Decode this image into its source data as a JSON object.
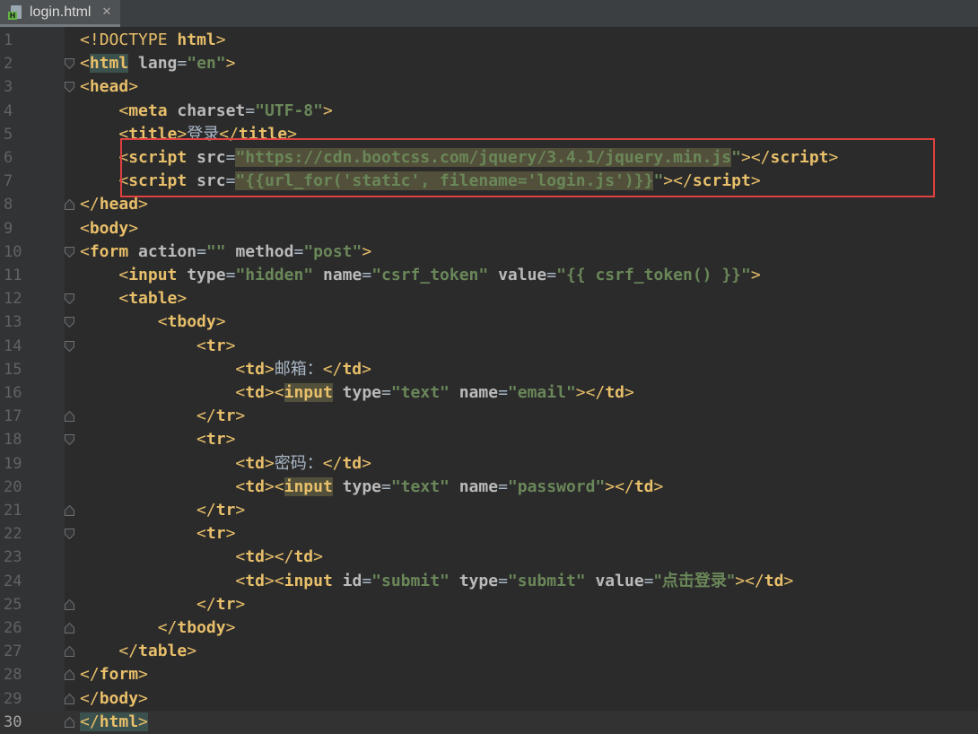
{
  "tab": {
    "filename": "login.html",
    "close_glyph": "✕",
    "icon": "html-file-icon"
  },
  "active_line": 30,
  "lines": [
    {
      "n": "1",
      "tokens": [
        [
          "tb",
          "<!"
        ],
        [
          "tb",
          "DOCTYPE "
        ],
        [
          "tn",
          "html"
        ],
        [
          "tb",
          ">"
        ]
      ]
    },
    {
      "n": "2",
      "tokens": [
        [
          "tb",
          "<"
        ],
        [
          "tn",
          "html",
          "hl"
        ],
        [
          "tx",
          " "
        ],
        [
          "an",
          "lang"
        ],
        [
          "tx",
          "="
        ],
        [
          "av",
          "\"en\""
        ],
        [
          "tb",
          ">"
        ]
      ]
    },
    {
      "n": "3",
      "tokens": [
        [
          "tb",
          "<"
        ],
        [
          "tn",
          "head"
        ],
        [
          "tb",
          ">"
        ]
      ]
    },
    {
      "n": "4",
      "tokens": [
        [
          "tx",
          "    "
        ],
        [
          "tb",
          "<"
        ],
        [
          "tn",
          "meta"
        ],
        [
          "tx",
          " "
        ],
        [
          "an",
          "charset"
        ],
        [
          "tx",
          "="
        ],
        [
          "av",
          "\"UTF-8\""
        ],
        [
          "tb",
          ">"
        ]
      ]
    },
    {
      "n": "5",
      "tokens": [
        [
          "tx",
          "    "
        ],
        [
          "tb",
          "<"
        ],
        [
          "tn",
          "title"
        ],
        [
          "tb",
          ">"
        ],
        [
          "tx",
          "登录",
          "cjk"
        ],
        [
          "tb",
          "</"
        ],
        [
          "tn",
          "title"
        ],
        [
          "tb",
          ">"
        ]
      ]
    },
    {
      "n": "6",
      "tokens": [
        [
          "tx",
          "    "
        ],
        [
          "tb",
          "<"
        ],
        [
          "tn",
          "script"
        ],
        [
          "tx",
          " "
        ],
        [
          "an",
          "src"
        ],
        [
          "tx",
          "="
        ],
        [
          "av",
          "\"https://cdn.bootcss.com/jquery/3.4.1/jquery.min.js",
          "hlm"
        ],
        [
          "av",
          "\""
        ],
        [
          "tb",
          ">"
        ],
        [
          "tb",
          "</"
        ],
        [
          "tn",
          "script"
        ],
        [
          "tb",
          ">"
        ]
      ]
    },
    {
      "n": "7",
      "tokens": [
        [
          "tx",
          "    "
        ],
        [
          "tb",
          "<"
        ],
        [
          "tn",
          "script"
        ],
        [
          "tx",
          " "
        ],
        [
          "an",
          "src"
        ],
        [
          "tx",
          "="
        ],
        [
          "av",
          "\"{{url_for('static', filename='login.js')}}",
          "hlm"
        ],
        [
          "av",
          "\""
        ],
        [
          "tb",
          ">"
        ],
        [
          "tb",
          "</"
        ],
        [
          "tn",
          "script"
        ],
        [
          "tb",
          ">"
        ]
      ]
    },
    {
      "n": "8",
      "tokens": [
        [
          "tb",
          "</"
        ],
        [
          "tn",
          "head"
        ],
        [
          "tb",
          ">"
        ]
      ]
    },
    {
      "n": "9",
      "tokens": [
        [
          "tb",
          "<"
        ],
        [
          "tn",
          "body"
        ],
        [
          "tb",
          ">"
        ]
      ]
    },
    {
      "n": "10",
      "tokens": [
        [
          "tb",
          "<"
        ],
        [
          "tn",
          "form"
        ],
        [
          "tx",
          " "
        ],
        [
          "an",
          "action"
        ],
        [
          "tx",
          "="
        ],
        [
          "av",
          "\"\""
        ],
        [
          "tx",
          " "
        ],
        [
          "an",
          "method"
        ],
        [
          "tx",
          "="
        ],
        [
          "av",
          "\"post\""
        ],
        [
          "tb",
          ">"
        ]
      ]
    },
    {
      "n": "11",
      "tokens": [
        [
          "tx",
          "    "
        ],
        [
          "tb",
          "<"
        ],
        [
          "tn",
          "input"
        ],
        [
          "tx",
          " "
        ],
        [
          "an",
          "type"
        ],
        [
          "tx",
          "="
        ],
        [
          "av",
          "\"hidden\""
        ],
        [
          "tx",
          " "
        ],
        [
          "an",
          "name"
        ],
        [
          "tx",
          "="
        ],
        [
          "av",
          "\"csrf_token\""
        ],
        [
          "tx",
          " "
        ],
        [
          "an",
          "value"
        ],
        [
          "tx",
          "="
        ],
        [
          "av",
          "\"{{ csrf_token() }}\""
        ],
        [
          "tb",
          ">"
        ]
      ]
    },
    {
      "n": "12",
      "tokens": [
        [
          "tx",
          "    "
        ],
        [
          "tb",
          "<"
        ],
        [
          "tn",
          "table"
        ],
        [
          "tb",
          ">"
        ]
      ]
    },
    {
      "n": "13",
      "tokens": [
        [
          "tx",
          "        "
        ],
        [
          "tb",
          "<"
        ],
        [
          "tn",
          "tbody"
        ],
        [
          "tb",
          ">"
        ]
      ]
    },
    {
      "n": "14",
      "tokens": [
        [
          "tx",
          "            "
        ],
        [
          "tb",
          "<"
        ],
        [
          "tn",
          "tr"
        ],
        [
          "tb",
          ">"
        ]
      ]
    },
    {
      "n": "15",
      "tokens": [
        [
          "tx",
          "                "
        ],
        [
          "tb",
          "<"
        ],
        [
          "tn",
          "td"
        ],
        [
          "tb",
          ">"
        ],
        [
          "tx",
          "邮箱：",
          "cjk"
        ],
        [
          "tb",
          "</"
        ],
        [
          "tn",
          "td"
        ],
        [
          "tb",
          ">"
        ]
      ]
    },
    {
      "n": "16",
      "tokens": [
        [
          "tx",
          "                "
        ],
        [
          "tb",
          "<"
        ],
        [
          "tn",
          "td"
        ],
        [
          "tb",
          ">"
        ],
        [
          "tb",
          "<"
        ],
        [
          "tn",
          "input",
          "hlm"
        ],
        [
          "tx",
          " "
        ],
        [
          "an",
          "type"
        ],
        [
          "tx",
          "="
        ],
        [
          "av",
          "\"text\""
        ],
        [
          "tx",
          " "
        ],
        [
          "an",
          "name"
        ],
        [
          "tx",
          "="
        ],
        [
          "av",
          "\"email\""
        ],
        [
          "tb",
          ">"
        ],
        [
          "tb",
          "</"
        ],
        [
          "tn",
          "td"
        ],
        [
          "tb",
          ">"
        ]
      ]
    },
    {
      "n": "17",
      "tokens": [
        [
          "tx",
          "            "
        ],
        [
          "tb",
          "</"
        ],
        [
          "tn",
          "tr"
        ],
        [
          "tb",
          ">"
        ]
      ]
    },
    {
      "n": "18",
      "tokens": [
        [
          "tx",
          "            "
        ],
        [
          "tb",
          "<"
        ],
        [
          "tn",
          "tr"
        ],
        [
          "tb",
          ">"
        ]
      ]
    },
    {
      "n": "19",
      "tokens": [
        [
          "tx",
          "                "
        ],
        [
          "tb",
          "<"
        ],
        [
          "tn",
          "td"
        ],
        [
          "tb",
          ">"
        ],
        [
          "tx",
          "密码：",
          "cjk"
        ],
        [
          "tb",
          "</"
        ],
        [
          "tn",
          "td"
        ],
        [
          "tb",
          ">"
        ]
      ]
    },
    {
      "n": "20",
      "tokens": [
        [
          "tx",
          "                "
        ],
        [
          "tb",
          "<"
        ],
        [
          "tn",
          "td"
        ],
        [
          "tb",
          ">"
        ],
        [
          "tb",
          "<"
        ],
        [
          "tn",
          "input",
          "hlm"
        ],
        [
          "tx",
          " "
        ],
        [
          "an",
          "type"
        ],
        [
          "tx",
          "="
        ],
        [
          "av",
          "\"text\""
        ],
        [
          "tx",
          " "
        ],
        [
          "an",
          "name"
        ],
        [
          "tx",
          "="
        ],
        [
          "av",
          "\"password\""
        ],
        [
          "tb",
          ">"
        ],
        [
          "tb",
          "</"
        ],
        [
          "tn",
          "td"
        ],
        [
          "tb",
          ">"
        ]
      ]
    },
    {
      "n": "21",
      "tokens": [
        [
          "tx",
          "            "
        ],
        [
          "tb",
          "</"
        ],
        [
          "tn",
          "tr"
        ],
        [
          "tb",
          ">"
        ]
      ]
    },
    {
      "n": "22",
      "tokens": [
        [
          "tx",
          "            "
        ],
        [
          "tb",
          "<"
        ],
        [
          "tn",
          "tr"
        ],
        [
          "tb",
          ">"
        ]
      ]
    },
    {
      "n": "23",
      "tokens": [
        [
          "tx",
          "                "
        ],
        [
          "tb",
          "<"
        ],
        [
          "tn",
          "td"
        ],
        [
          "tb",
          ">"
        ],
        [
          "tb",
          "</"
        ],
        [
          "tn",
          "td"
        ],
        [
          "tb",
          ">"
        ]
      ]
    },
    {
      "n": "24",
      "tokens": [
        [
          "tx",
          "                "
        ],
        [
          "tb",
          "<"
        ],
        [
          "tn",
          "td"
        ],
        [
          "tb",
          ">"
        ],
        [
          "tb",
          "<"
        ],
        [
          "tn",
          "input"
        ],
        [
          "tx",
          " "
        ],
        [
          "an",
          "id"
        ],
        [
          "tx",
          "="
        ],
        [
          "av",
          "\"submit\""
        ],
        [
          "tx",
          " "
        ],
        [
          "an",
          "type"
        ],
        [
          "tx",
          "="
        ],
        [
          "av",
          "\"submit\""
        ],
        [
          "tx",
          " "
        ],
        [
          "an",
          "value"
        ],
        [
          "tx",
          "="
        ],
        [
          "av",
          "\"点击登录\"",
          "cjk"
        ],
        [
          "tb",
          ">"
        ],
        [
          "tb",
          "</"
        ],
        [
          "tn",
          "td"
        ],
        [
          "tb",
          ">"
        ]
      ]
    },
    {
      "n": "25",
      "tokens": [
        [
          "tx",
          "            "
        ],
        [
          "tb",
          "</"
        ],
        [
          "tn",
          "tr"
        ],
        [
          "tb",
          ">"
        ]
      ]
    },
    {
      "n": "26",
      "tokens": [
        [
          "tx",
          "        "
        ],
        [
          "tb",
          "</"
        ],
        [
          "tn",
          "tbody"
        ],
        [
          "tb",
          ">"
        ]
      ]
    },
    {
      "n": "27",
      "tokens": [
        [
          "tx",
          "    "
        ],
        [
          "tb",
          "</"
        ],
        [
          "tn",
          "table"
        ],
        [
          "tb",
          ">"
        ]
      ]
    },
    {
      "n": "28",
      "tokens": [
        [
          "tb",
          "</"
        ],
        [
          "tn",
          "form"
        ],
        [
          "tb",
          ">"
        ]
      ]
    },
    {
      "n": "29",
      "tokens": [
        [
          "tb",
          "</"
        ],
        [
          "tn",
          "body"
        ],
        [
          "tb",
          ">"
        ]
      ]
    },
    {
      "n": "30",
      "tokens": [
        [
          "tb",
          "<",
          "hl"
        ],
        [
          "tb",
          "/",
          "hl"
        ],
        [
          "tn",
          "html",
          "hl"
        ],
        [
          "tb",
          ">",
          "hl"
        ]
      ]
    }
  ],
  "folds": {
    "2": "open",
    "3": "open",
    "8": "close",
    "10": "open",
    "12": "open",
    "13": "open",
    "14": "open",
    "17": "close",
    "18": "open",
    "21": "close",
    "22": "open",
    "25": "close",
    "26": "close",
    "27": "close",
    "28": "close",
    "29": "close",
    "30": "close"
  },
  "colors": {
    "background": "#2b2b2b",
    "gutter": "#313335",
    "tag": "#e8bf6a",
    "attribute": "#bababa",
    "string": "#6a8759",
    "text": "#a9b7c6",
    "highlight_box": "#e04040"
  }
}
